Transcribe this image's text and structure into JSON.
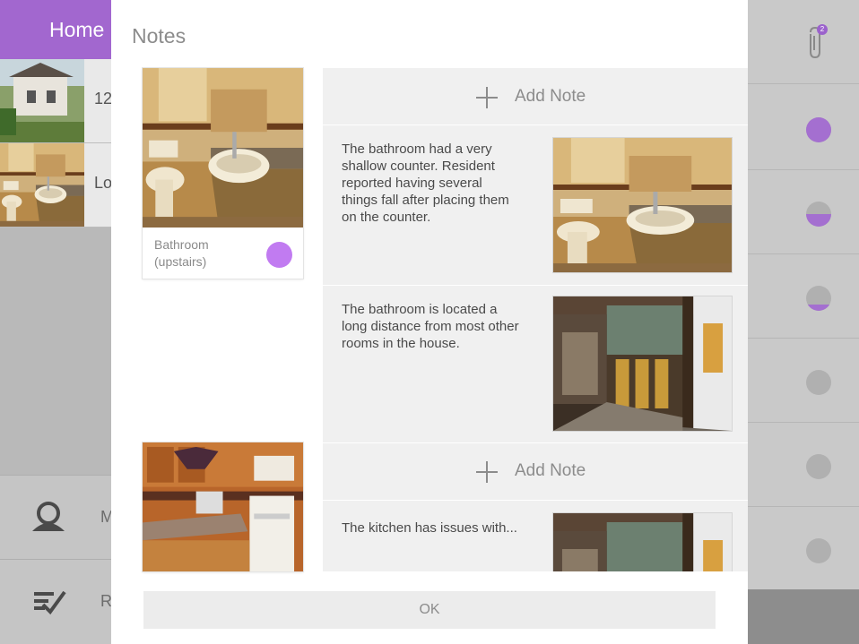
{
  "background": {
    "header_title": "Home",
    "list_rows": [
      {
        "text": "12"
      },
      {
        "text": "Lo"
      }
    ],
    "bottom_rows": [
      {
        "icon": "user-icon",
        "text": "M"
      },
      {
        "icon": "checklist-icon",
        "text": "R"
      }
    ],
    "attachments_badge": "2",
    "status_levels": [
      1.0,
      0.5,
      0.25,
      0,
      0,
      0
    ]
  },
  "modal": {
    "title": "Notes",
    "rooms": [
      {
        "label": "Bathroom (upstairs)",
        "photo": "bathroom-photo",
        "status_color": "#c17bf1"
      },
      {
        "label": "",
        "photo": "kitchen-photo"
      }
    ],
    "add_note_label": "Add Note",
    "notes": [
      {
        "text": "The bathroom had a very shallow counter. Resident reported having several things fall after placing them on the counter.",
        "photo": "bathroom-photo"
      },
      {
        "text": "The bathroom is located a long distance from most other rooms in the house.",
        "photo": "hallway-photo"
      },
      {
        "text": "The kitchen has issues with...",
        "photo": "hallway-photo"
      }
    ],
    "ok_label": "OK"
  },
  "colors": {
    "accent": "#a267cf",
    "status_purple": "#c17bf1",
    "panel_bg": "#f0f0f0"
  }
}
